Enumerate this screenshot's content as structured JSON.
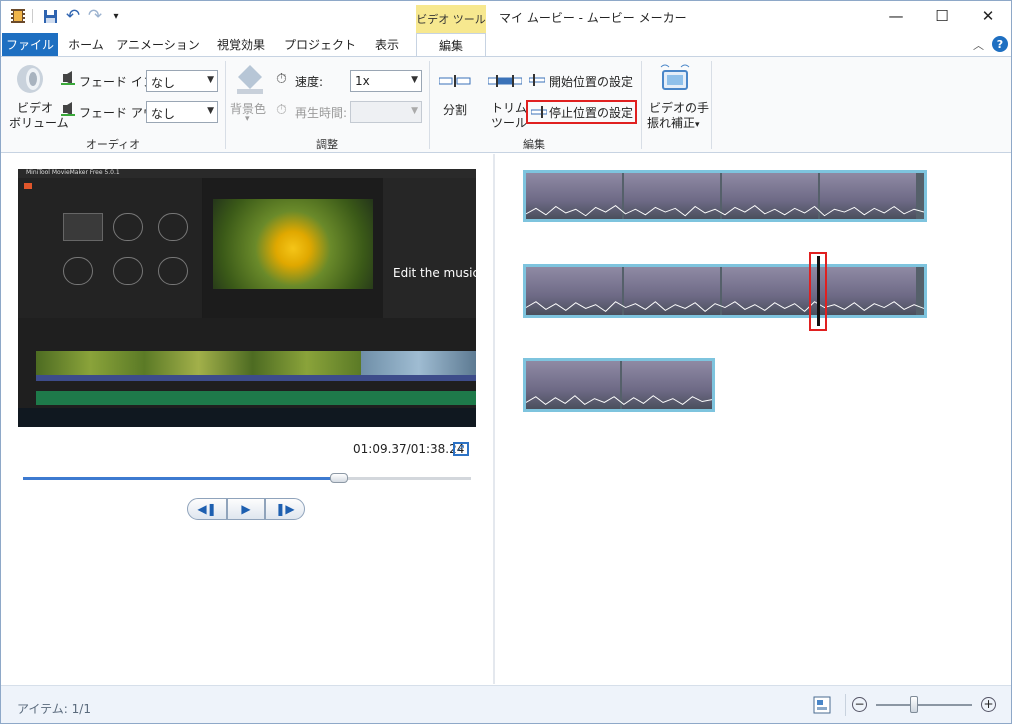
{
  "window": {
    "title": "マイ ムービー - ムービー メーカー",
    "context_tab": "ビデオ ツール",
    "minimize_icon": "minimize-icon",
    "maximize_icon": "maximize-icon",
    "close_icon": "close-icon"
  },
  "tabs": [
    {
      "label": "ファイル"
    },
    {
      "label": "ホーム"
    },
    {
      "label": "アニメーション"
    },
    {
      "label": "視覚効果"
    },
    {
      "label": "プロジェクト"
    },
    {
      "label": "表示"
    },
    {
      "label": "編集"
    }
  ],
  "ribbon": {
    "audio": {
      "volume_label_1": "ビデオ",
      "volume_label_2": "ボリューム",
      "fade_in_label": "フェード イン:",
      "fade_in_value": "なし",
      "fade_out_label": "フェード アウト:",
      "fade_out_value": "なし",
      "group_label": "オーディオ"
    },
    "adjust": {
      "bg_color_label": "背景色",
      "speed_label": "速度:",
      "speed_value": "1x",
      "duration_label": "再生時間:",
      "duration_value": "",
      "group_label": "調整"
    },
    "edit": {
      "split_label": "分割",
      "trim_label_1": "トリム",
      "trim_label_2": "ツール",
      "set_start_label": "開始位置の設定",
      "set_end_label": "停止位置の設定",
      "group_label": "編集"
    },
    "stabilize": {
      "label_1": "ビデオの手",
      "label_2": "振れ補正",
      "arrow": "▾"
    }
  },
  "preview": {
    "overlay_text": "Edit the music",
    "app_title": "MiniTool MovieMaker Free 5.0.1",
    "timecode": "01:09.37/01:38.24",
    "seek_fraction": 0.705
  },
  "status": {
    "items_text": "アイテム: 1/1",
    "zoom_fraction": 0.4
  },
  "colors": {
    "accent": "#1e6fc1",
    "context_tab": "#f7e88f",
    "highlight": "#e02020",
    "film_border": "#7ec4de"
  }
}
